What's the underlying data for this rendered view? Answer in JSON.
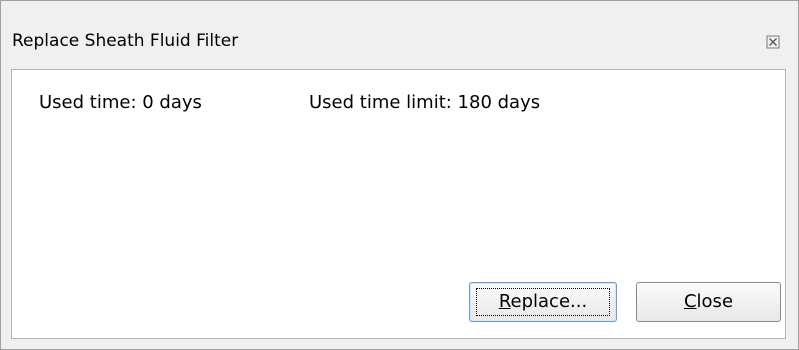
{
  "dialog": {
    "title": "Replace Sheath Fluid Filter",
    "close_icon": "close-icon"
  },
  "info": {
    "used_time": "Used time: 0 days",
    "used_time_limit": "Used time limit: 180 days"
  },
  "buttons": {
    "replace": {
      "accel": "R",
      "rest": "eplace..."
    },
    "close": {
      "accel": "C",
      "rest": "lose"
    }
  },
  "colors": {
    "frame": "#f0f0f0",
    "panel": "#ffffff",
    "focus_border": "#6a9bd8"
  }
}
